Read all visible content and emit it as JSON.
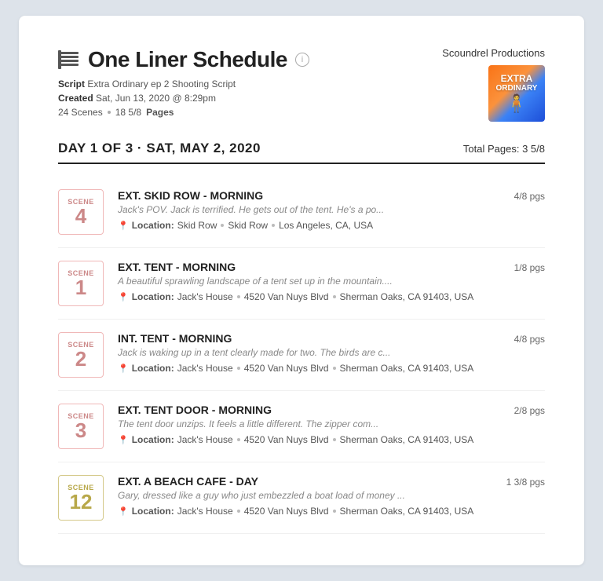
{
  "header": {
    "title": "One Liner Schedule",
    "production": "Scoundrel Productions",
    "script_label": "Script",
    "script_value": "Extra Ordinary ep 2 Shooting Script",
    "created_label": "Created",
    "created_value": "Sat, Jun 13, 2020 @ 8:29pm",
    "scenes_count": "24 Scenes",
    "pages_label": "Pages",
    "pages_count": "18 5/8",
    "thumbnail_line1": "EXTRA",
    "thumbnail_line2": "ORDINARY"
  },
  "day": {
    "label": "DAY 1 OF 3  ·  SAT, MAY 2, 2020",
    "total_pages_label": "Total Pages: 3 5/8"
  },
  "scenes": [
    {
      "number": "4",
      "badge_type": "pink",
      "title": "EXT. SKID ROW - MORNING",
      "description": "Jack's POV. Jack is terrified. He gets out of the tent. He's a po...",
      "location": "Location:",
      "location_parts": [
        "Skid Row",
        "Skid Row",
        "Los Angeles, CA, USA"
      ],
      "pages": "4/8 pgs"
    },
    {
      "number": "1",
      "badge_type": "pink",
      "title": "EXT. TENT - MORNING",
      "description": "A beautiful sprawling landscape of a tent set up in the mountain....",
      "location": "Location:",
      "location_parts": [
        "Jack's House",
        "4520 Van Nuys Blvd",
        "Sherman Oaks, CA 91403, USA"
      ],
      "pages": "1/8 pgs"
    },
    {
      "number": "2",
      "badge_type": "pink",
      "title": "INT. TENT - MORNING",
      "description": "Jack is waking up in a tent clearly made for two. The birds are c...",
      "location": "Location:",
      "location_parts": [
        "Jack's House",
        "4520 Van Nuys Blvd",
        "Sherman Oaks, CA 91403, USA"
      ],
      "pages": "4/8 pgs"
    },
    {
      "number": "3",
      "badge_type": "pink",
      "title": "EXT. TENT DOOR - MORNING",
      "description": "The tent door unzips. It feels a little different. The zipper com...",
      "location": "Location:",
      "location_parts": [
        "Jack's House",
        "4520 Van Nuys Blvd",
        "Sherman Oaks, CA 91403, USA"
      ],
      "pages": "2/8 pgs"
    },
    {
      "number": "12",
      "badge_type": "yellow",
      "title": "EXT. A BEACH CAFE - DAY",
      "description": "Gary, dressed like a guy who just embezzled a boat load of money ...",
      "location": "Location:",
      "location_parts": [
        "Jack's House",
        "4520 Van Nuys Blvd",
        "Sherman Oaks, CA 91403, USA"
      ],
      "pages": "1 3/8 pgs"
    }
  ]
}
